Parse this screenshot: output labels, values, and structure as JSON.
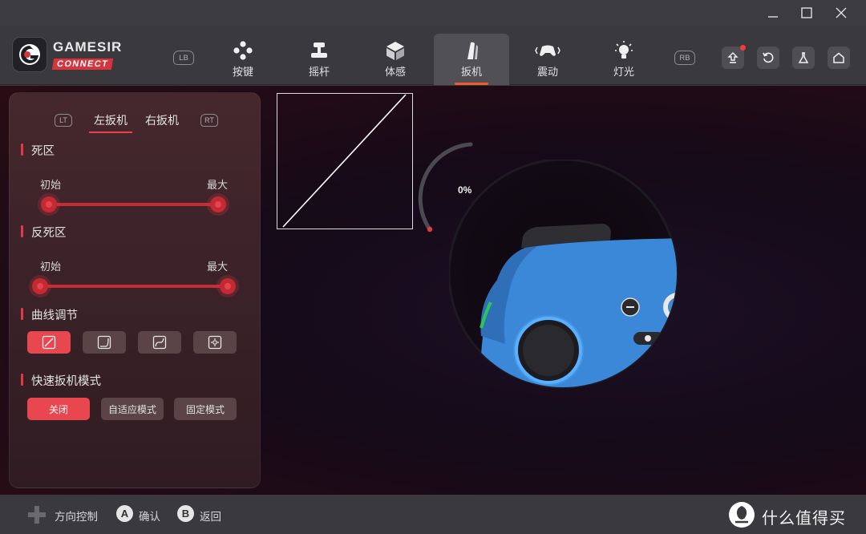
{
  "window": {
    "controls": [
      "minimize-icon",
      "maximize-icon",
      "close-icon"
    ]
  },
  "brand": {
    "name": "GAMESIR",
    "sub": "CONNECT",
    "accent": "#d8343d"
  },
  "nav": {
    "left_bumper": "LB",
    "right_bumper": "RB",
    "tabs": [
      {
        "label": "按键",
        "icon": "buttons-icon"
      },
      {
        "label": "摇杆",
        "icon": "joystick-icon"
      },
      {
        "label": "体感",
        "icon": "motion-cube-icon"
      },
      {
        "label": "扳机",
        "icon": "trigger-icon",
        "active": true
      },
      {
        "label": "震动",
        "icon": "vibration-icon"
      },
      {
        "label": "灯光",
        "icon": "light-bulb-icon"
      }
    ],
    "actions": [
      "upgrade-icon",
      "reset-icon",
      "lab-flask-icon",
      "home-icon"
    ]
  },
  "panel": {
    "lt": "LT",
    "rt": "RT",
    "tabs": [
      "左扳机",
      "右扳机"
    ],
    "active_tab": 0,
    "deadzone": {
      "title": "死区",
      "start_label": "初始",
      "max_label": "最大"
    },
    "anti_deadzone": {
      "title": "反死区",
      "start_label": "初始",
      "max_label": "最大"
    },
    "curve": {
      "title": "曲线调节",
      "options": [
        "linear-curve-icon",
        "slow-start-curve-icon",
        "s-curve-icon",
        "custom-curve-icon"
      ],
      "active_index": 0
    },
    "quick_trigger": {
      "title": "快速扳机模式",
      "options": [
        "关闭",
        "自适应模式",
        "固定模式"
      ],
      "active_index": 0
    }
  },
  "preview": {
    "gauge_value": "0%",
    "accent": "#e03a44",
    "controller_color": "#3c88d8"
  },
  "footer": {
    "dpad_label": "方向控制",
    "a_key": "A",
    "a_label": "确认",
    "b_key": "B",
    "b_label": "返回",
    "watermark": "什么值得买"
  }
}
